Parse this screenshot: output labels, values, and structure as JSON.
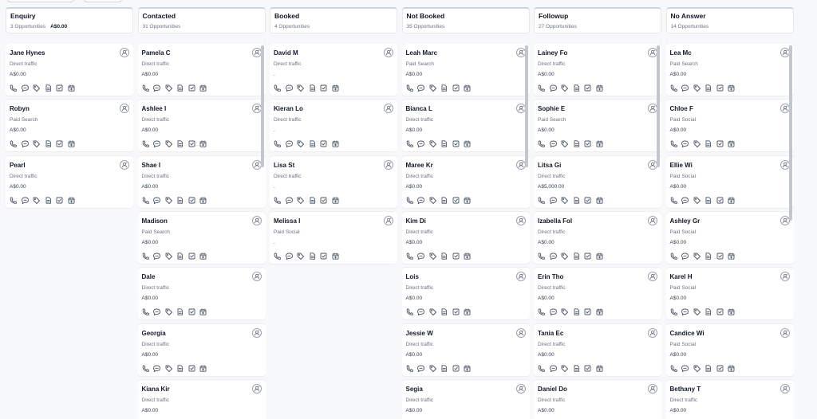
{
  "columns": [
    {
      "title": "Enquiry",
      "subtitle": "3 Opportunities",
      "total": "A$0.00",
      "cards": [
        {
          "name": "Jane Hynes",
          "source": "Direct traffic",
          "value": "A$0.00"
        },
        {
          "name": "Robyn",
          "source": "Paid Search",
          "value": "A$0.00"
        },
        {
          "name": "Pearl",
          "source": "Direct traffic",
          "value": "A$0.00"
        }
      ]
    },
    {
      "title": "Contacted",
      "subtitle": "31 Opportunities",
      "total": "",
      "cards": [
        {
          "name": "Pamela C",
          "source": "Direct traffic",
          "value": "A$0.00"
        },
        {
          "name": "Ashlee I",
          "source": "Direct traffic",
          "value": "A$0.00"
        },
        {
          "name": "Shae I",
          "source": "Direct traffic",
          "value": "A$0.00"
        },
        {
          "name": "Madison",
          "source": "Paid Search",
          "value": "A$0.00"
        },
        {
          "name": "Dale",
          "source": "Direct traffic",
          "value": "A$0.00"
        },
        {
          "name": "Georgia",
          "source": "Direct traffic",
          "value": "A$0.00"
        },
        {
          "name": "Kiana Kir",
          "source": "Direct traffic",
          "value": "A$0.00"
        }
      ]
    },
    {
      "title": "Booked",
      "subtitle": "4 Opportunities",
      "total": "",
      "cards": [
        {
          "name": "David M",
          "source": "Direct traffic",
          "value": "."
        },
        {
          "name": "Kieran Lo",
          "source": "Direct traffic",
          "value": "."
        },
        {
          "name": "Lisa St",
          "source": "Direct traffic",
          "value": "."
        },
        {
          "name": "Melissa I",
          "source": "Paid Social",
          "value": "."
        }
      ]
    },
    {
      "title": "Not Booked",
      "subtitle": "35 Opportunities",
      "total": "",
      "cards": [
        {
          "name": "Leah Marc",
          "source": "Paid Search",
          "value": "A$0.00"
        },
        {
          "name": "Bianca L",
          "source": "Direct traffic",
          "value": "A$0.00"
        },
        {
          "name": "Maree Kr",
          "source": "Direct traffic",
          "value": "A$0.00"
        },
        {
          "name": "Kim Di",
          "source": "Direct traffic",
          "value": "A$0.00"
        },
        {
          "name": "Lois",
          "source": "Direct traffic",
          "value": "A$0.00"
        },
        {
          "name": "Jessie W",
          "source": "Direct traffic",
          "value": "A$0.00"
        },
        {
          "name": "Segia",
          "source": "Direct traffic",
          "value": "A$0.00"
        }
      ]
    },
    {
      "title": "Followup",
      "subtitle": "27 Opportunities",
      "total": "",
      "cards": [
        {
          "name": "Lainey Fo",
          "source": "Direct traffic",
          "value": "A$0.00"
        },
        {
          "name": "Sophie E",
          "source": "Paid Search",
          "value": "A$0.00"
        },
        {
          "name": "Litsa Gi",
          "source": "Direct traffic",
          "value": "A$5,000.00"
        },
        {
          "name": "Izabella Fol",
          "source": "Direct traffic",
          "value": "A$0.00"
        },
        {
          "name": "Erin Tho",
          "source": "Direct traffic",
          "value": "A$0.00"
        },
        {
          "name": "Tania Ec",
          "source": "Direct traffic",
          "value": "A$0.00"
        },
        {
          "name": "Daniel Do",
          "source": "Direct traffic",
          "value": "A$0.00"
        }
      ]
    },
    {
      "title": "No Answer",
      "subtitle": "14 Opportunities",
      "total": "",
      "cards": [
        {
          "name": "Lea Mc",
          "source": "Paid Search",
          "value": "A$0.00"
        },
        {
          "name": "Chloe F",
          "source": "Paid Social",
          "value": "A$0.00"
        },
        {
          "name": "Ellie Wi",
          "source": "Paid Social",
          "value": "A$0.00"
        },
        {
          "name": "Ashley Gr",
          "source": "Paid Social",
          "value": "A$0.00"
        },
        {
          "name": "Karel H",
          "source": "Paid Social",
          "value": "A$0.00"
        },
        {
          "name": "Candice Wi",
          "source": "Paid Social",
          "value": "A$0.00"
        },
        {
          "name": "Bethany T",
          "source": "Direct traffic",
          "value": "A$0.00"
        }
      ]
    }
  ],
  "card_action_icons": [
    "phone-icon",
    "chat-icon",
    "tag-icon",
    "note-icon",
    "task-icon",
    "calendar-icon"
  ],
  "card_owner_icon": "user-icon"
}
